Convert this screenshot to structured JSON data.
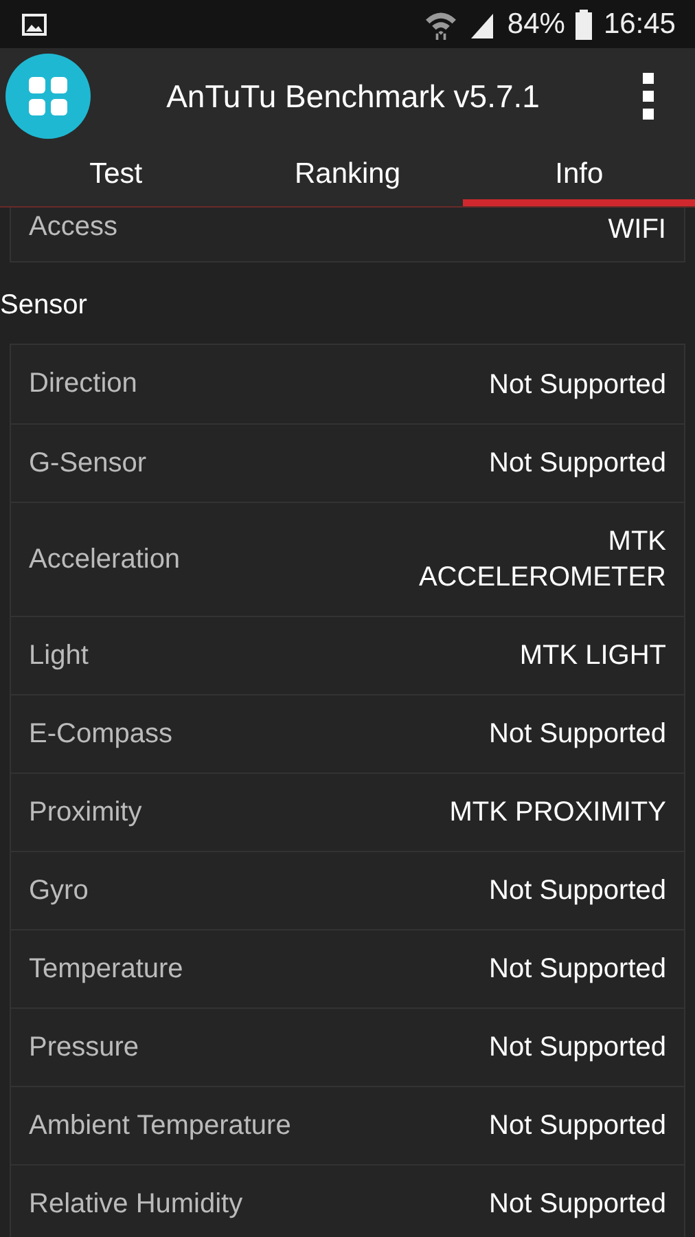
{
  "status_bar": {
    "battery": "84%",
    "time": "16:45"
  },
  "app_bar": {
    "title": "AnTuTu Benchmark v5.7.1"
  },
  "tabs": [
    {
      "label": "Test",
      "selected": false
    },
    {
      "label": "Ranking",
      "selected": false
    },
    {
      "label": "Info",
      "selected": true
    }
  ],
  "partial_section": {
    "rows": [
      {
        "label": "Access",
        "value": "WIFI"
      }
    ]
  },
  "sections": [
    {
      "title": "Sensor",
      "rows": [
        {
          "label": "Direction",
          "value": "Not Supported"
        },
        {
          "label": "G-Sensor",
          "value": "Not Supported"
        },
        {
          "label": "Acceleration",
          "value": "MTK ACCELEROMETER"
        },
        {
          "label": "Light",
          "value": "MTK LIGHT"
        },
        {
          "label": "E-Compass",
          "value": "Not Supported"
        },
        {
          "label": "Proximity",
          "value": "MTK PROXIMITY"
        },
        {
          "label": "Gyro",
          "value": "Not Supported"
        },
        {
          "label": "Temperature",
          "value": "Not Supported"
        },
        {
          "label": "Pressure",
          "value": "Not Supported"
        },
        {
          "label": "Ambient Temperature",
          "value": "Not Supported"
        },
        {
          "label": "Relative Humidity",
          "value": "Not Supported"
        }
      ]
    }
  ]
}
